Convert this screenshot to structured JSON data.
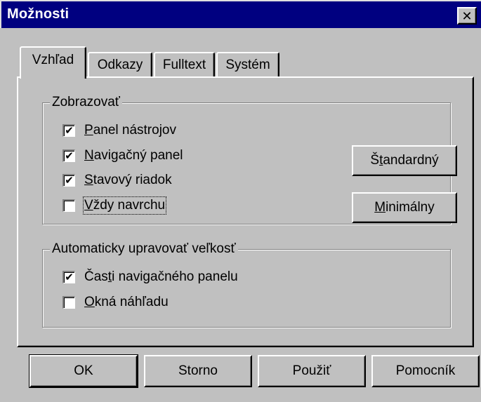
{
  "window": {
    "title": "Možnosti",
    "close_symbol": "✕"
  },
  "tabs": [
    {
      "label": "Vzhľad",
      "active": true
    },
    {
      "label": "Odkazy",
      "active": false
    },
    {
      "label": "Fulltext",
      "active": false
    },
    {
      "label": "Systém",
      "active": false
    }
  ],
  "display_group": {
    "label": "Zobrazovať",
    "options": [
      {
        "pre": "",
        "u": "P",
        "post": "anel nástrojov",
        "checked": true
      },
      {
        "pre": "",
        "u": "N",
        "post": "avigačný panel",
        "checked": true
      },
      {
        "pre": "",
        "u": "S",
        "post": "tavový riadok",
        "checked": true
      },
      {
        "pre": "",
        "u": "V",
        "post": "ždy navrchu",
        "checked": false
      }
    ],
    "buttons": {
      "standard": {
        "pre": "Š",
        "u": "t",
        "post": "andardný"
      },
      "minimal": {
        "pre": "",
        "u": "M",
        "post": "inimálny"
      }
    }
  },
  "auto_group": {
    "label": "Automaticky upravovať veľkosť",
    "options": [
      {
        "pre": "Čas",
        "u": "t",
        "post": "i navigačného panelu",
        "checked": true
      },
      {
        "pre": "",
        "u": "O",
        "post": "kná náhľadu",
        "checked": false
      }
    ]
  },
  "check_mark": "✔",
  "footer": {
    "ok": "OK",
    "cancel": "Storno",
    "apply": "Použiť",
    "help": "Pomocník"
  },
  "icons": {
    "close": "close-icon",
    "check": "checkmark-icon"
  }
}
